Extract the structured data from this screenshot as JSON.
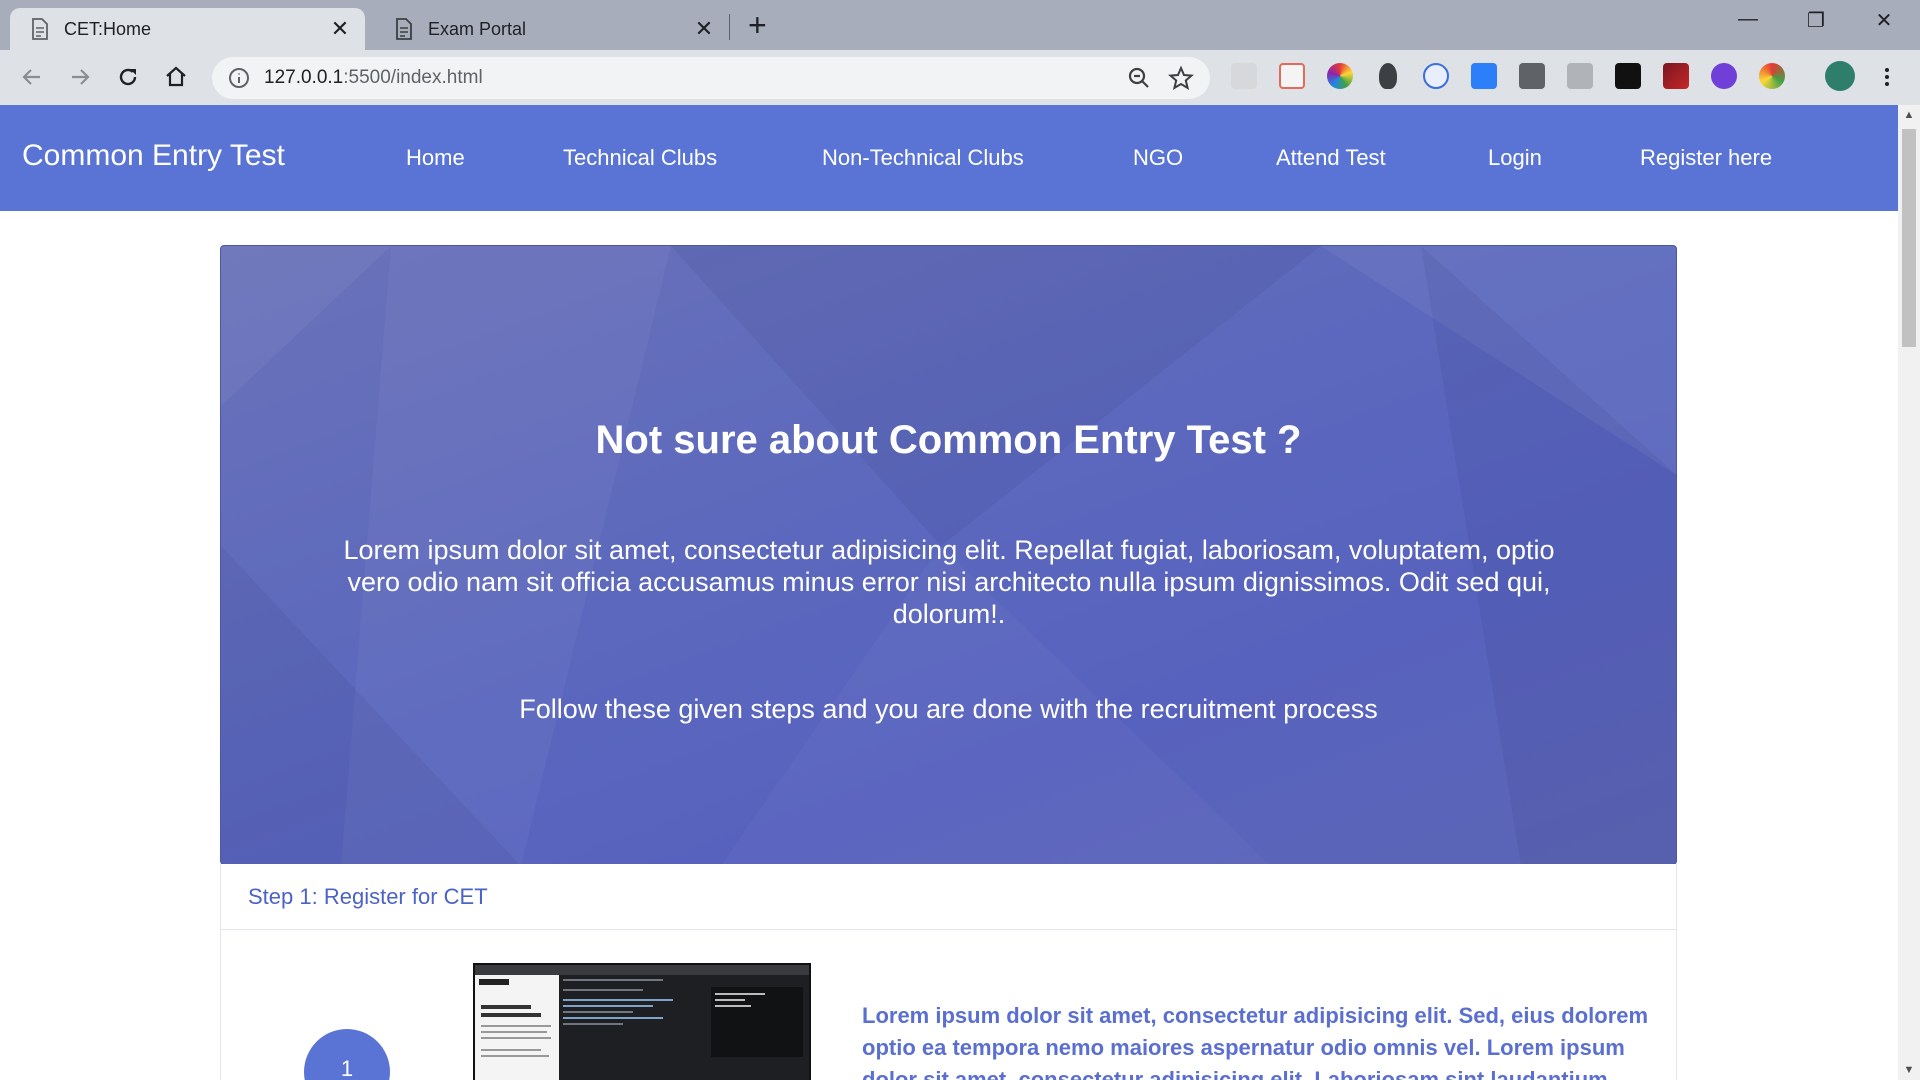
{
  "browser": {
    "tabs": [
      {
        "title": "CET:Home",
        "active": true
      },
      {
        "title": "Exam Portal",
        "active": false
      }
    ],
    "url_host": "127.0.0.1",
    "url_rest": ":5500/index.html",
    "icons": [
      "back-icon",
      "forward-icon",
      "reload-icon",
      "home-icon",
      "info-icon",
      "zoom-icon",
      "star-icon",
      "menu-icon"
    ]
  },
  "site": {
    "brand": "Common Entry Test",
    "nav": [
      "Home",
      "Technical Clubs",
      "Non-Technical Clubs",
      "NGO",
      "Attend Test",
      "Login",
      "Register here"
    ],
    "accent_color": "#5a74d6"
  },
  "hero": {
    "title": "Not sure about Common Entry Test ?",
    "text": "Lorem ipsum dolor sit amet, consectetur adipisicing elit. Repellat fugiat, laboriosam, voluptatem, optio vero odio nam sit officia accusamus minus error nisi architecto nulla ipsum dignissimos. Odit sed qui, dolorum!.",
    "follow": "Follow these given steps and you are done with the recruitment process"
  },
  "step1": {
    "header": "Step 1: Register for CET",
    "number": "1",
    "text": "Lorem ipsum dolor sit amet, consectetur adipisicing elit. Sed, eius dolorem optio ea tempora nemo maiores aspernatur odio omnis vel. Lorem ipsum dolor sit amet, consectetur adipisicing elit. Laboriosam sint laudantium"
  }
}
